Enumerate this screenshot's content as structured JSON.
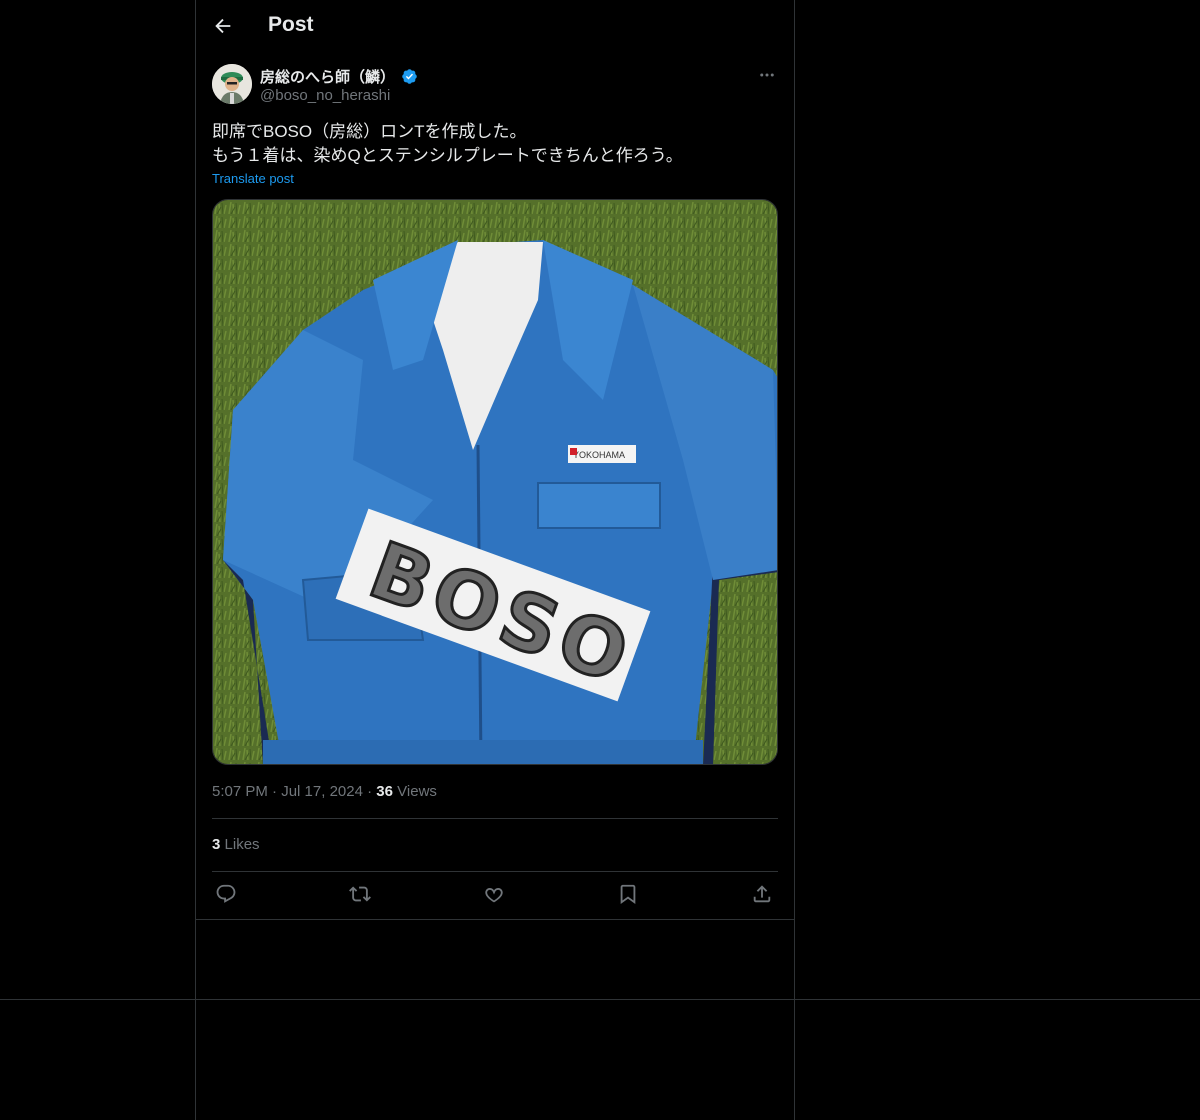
{
  "header": {
    "title": "Post",
    "back_icon": "arrow-left-icon"
  },
  "author": {
    "display_name": "房総のへら師（鱗）",
    "handle": "@boso_no_herashi",
    "verified": true,
    "verified_color": "#1d9bf0"
  },
  "post": {
    "text_lines": [
      "即席でBOSO（房総）ロンTを作成した。",
      "もう１着は、染めQとステンシルプレートできちんと作ろう。"
    ],
    "translate_label": "Translate post",
    "media_alt": "Blue work jumpsuit with YOKOHAMA patch and BOSO stencil sleeve on grass",
    "patch_text": "YOKOHAMA",
    "stencil_text": "BOSO"
  },
  "meta": {
    "time": "5:07 PM",
    "date": "Jul 17, 2024",
    "views_count": "36",
    "views_label": "Views",
    "separator": "·"
  },
  "stats": {
    "likes_count": "3",
    "likes_label": "Likes"
  },
  "actions": [
    {
      "name": "reply",
      "icon": "reply-icon"
    },
    {
      "name": "repost",
      "icon": "repost-icon"
    },
    {
      "name": "like",
      "icon": "heart-icon"
    },
    {
      "name": "bookmark",
      "icon": "bookmark-icon"
    },
    {
      "name": "share",
      "icon": "share-icon"
    }
  ],
  "colors": {
    "background": "#000000",
    "border": "#2f3336",
    "text_primary": "#e7e9ea",
    "text_secondary": "#71767b",
    "accent": "#1d9bf0"
  }
}
